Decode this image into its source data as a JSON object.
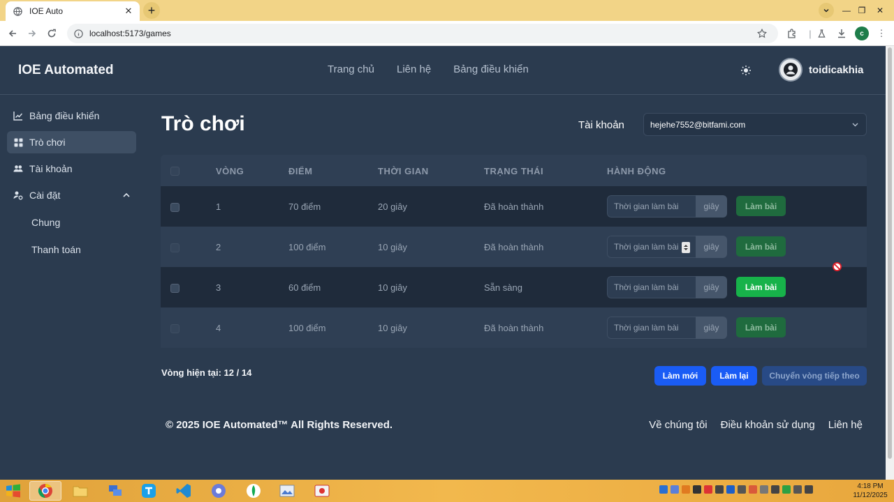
{
  "browser": {
    "tab_title": "IOE Auto",
    "url": "localhost:5173/games"
  },
  "header": {
    "brand": "IOE Automated",
    "nav": [
      "Trang chủ",
      "Liên hệ",
      "Bảng điều khiển"
    ],
    "username": "toidicakhia"
  },
  "sidebar": {
    "items": [
      {
        "label": "Bảng điều khiển",
        "icon": "chart-line-icon"
      },
      {
        "label": "Trò chơi",
        "icon": "grid-icon",
        "active": true
      },
      {
        "label": "Tài khoản",
        "icon": "users-icon"
      },
      {
        "label": "Cài đặt",
        "icon": "user-gear-icon",
        "expanded": true
      }
    ],
    "subitems": [
      "Chung",
      "Thanh toán"
    ]
  },
  "main": {
    "title": "Trò chơi",
    "account_label": "Tài khoản",
    "account_value": "hejehe7552@bitfami.com",
    "table": {
      "headers": [
        "VÒNG",
        "ĐIỂM",
        "THỜI GIAN",
        "TRẠNG THÁI",
        "HÀNH ĐỘNG"
      ],
      "rows": [
        {
          "round": "1",
          "score": "70 điểm",
          "time": "20 giây",
          "status": "Đã hoàn thành",
          "placeholder": "Thời gian làm bài",
          "unit": "giây",
          "action": "Làm bài",
          "enabled": false
        },
        {
          "round": "2",
          "score": "100 điểm",
          "time": "10 giây",
          "status": "Đã hoàn thành",
          "placeholder": "Thời gian làm bài",
          "unit": "giây",
          "action": "Làm bài",
          "enabled": false
        },
        {
          "round": "3",
          "score": "60 điểm",
          "time": "10 giây",
          "status": "Sẵn sàng",
          "placeholder": "Thời gian làm bài",
          "unit": "giây",
          "action": "Làm bài",
          "enabled": true
        },
        {
          "round": "4",
          "score": "100 điểm",
          "time": "10 giây",
          "status": "Đã hoàn thành",
          "placeholder": "Thời gian làm bài",
          "unit": "giây",
          "action": "Làm bài",
          "enabled": false
        }
      ]
    },
    "current_round": "Vòng hiện tại: 12 / 14",
    "buttons": {
      "refresh": "Làm mới",
      "redo": "Làm lại",
      "next": "Chuyển vòng tiếp theo"
    }
  },
  "footer": {
    "copyright": "© 2025 IOE Automated™ All Rights Reserved.",
    "links": [
      "Về chúng tôi",
      "Điều khoản sử dụng",
      "Liên hệ"
    ]
  },
  "taskbar": {
    "time": "4:18 PM",
    "date": "11/12/2025"
  },
  "colors": {
    "background": "#2b3b4f",
    "accent_blue": "#1a5cf5",
    "green_enabled": "#17b24a",
    "green_disabled": "#1f6b3e"
  }
}
